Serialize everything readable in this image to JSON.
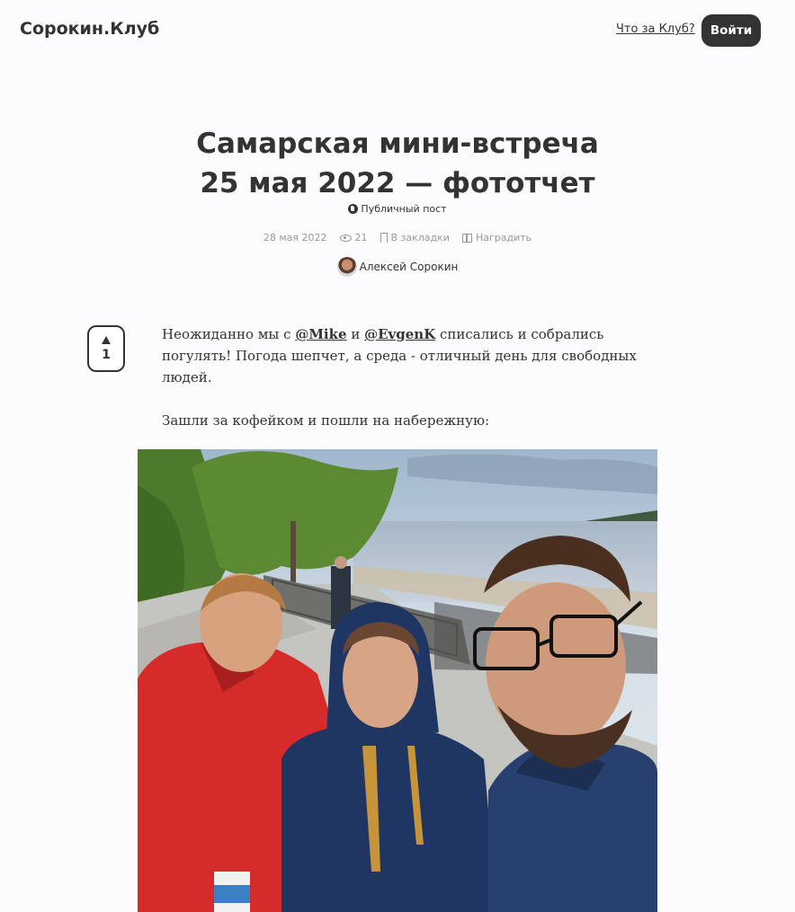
{
  "header": {
    "logo": "Сорокин.Клуб",
    "about_link": "Что за Клуб?",
    "login_label": "Войти"
  },
  "post": {
    "title_line1": "Самарская мини-встреча",
    "title_line2": "25 мая 2022 — фототчет",
    "visibility": "Публичный пост",
    "date": "28 мая 2022",
    "views": "21",
    "bookmark_label": "В закладки",
    "reward_label": "Наградить",
    "author": "Алексей Сорокин",
    "upvotes": "1",
    "paragraph1_before": "Неожиданно мы с ",
    "mention1": "@Mike",
    "paragraph1_middle": " и ",
    "mention2": "@EvgenK",
    "paragraph1_after": " списались и собрались погулять! Погода шепчет, а среда - отличный день для свободных людей.",
    "paragraph2": "Зашли за кофейком и пошли на набережную:"
  },
  "icons": {
    "visibility": "globe-icon",
    "views": "eye-icon",
    "bookmark": "bookmark-icon",
    "reward": "gift-icon",
    "upvote": "triangle-up-icon"
  },
  "colors": {
    "text": "#333333",
    "muted": "#999999",
    "background": "#fcfcfe",
    "button": "#333333"
  }
}
